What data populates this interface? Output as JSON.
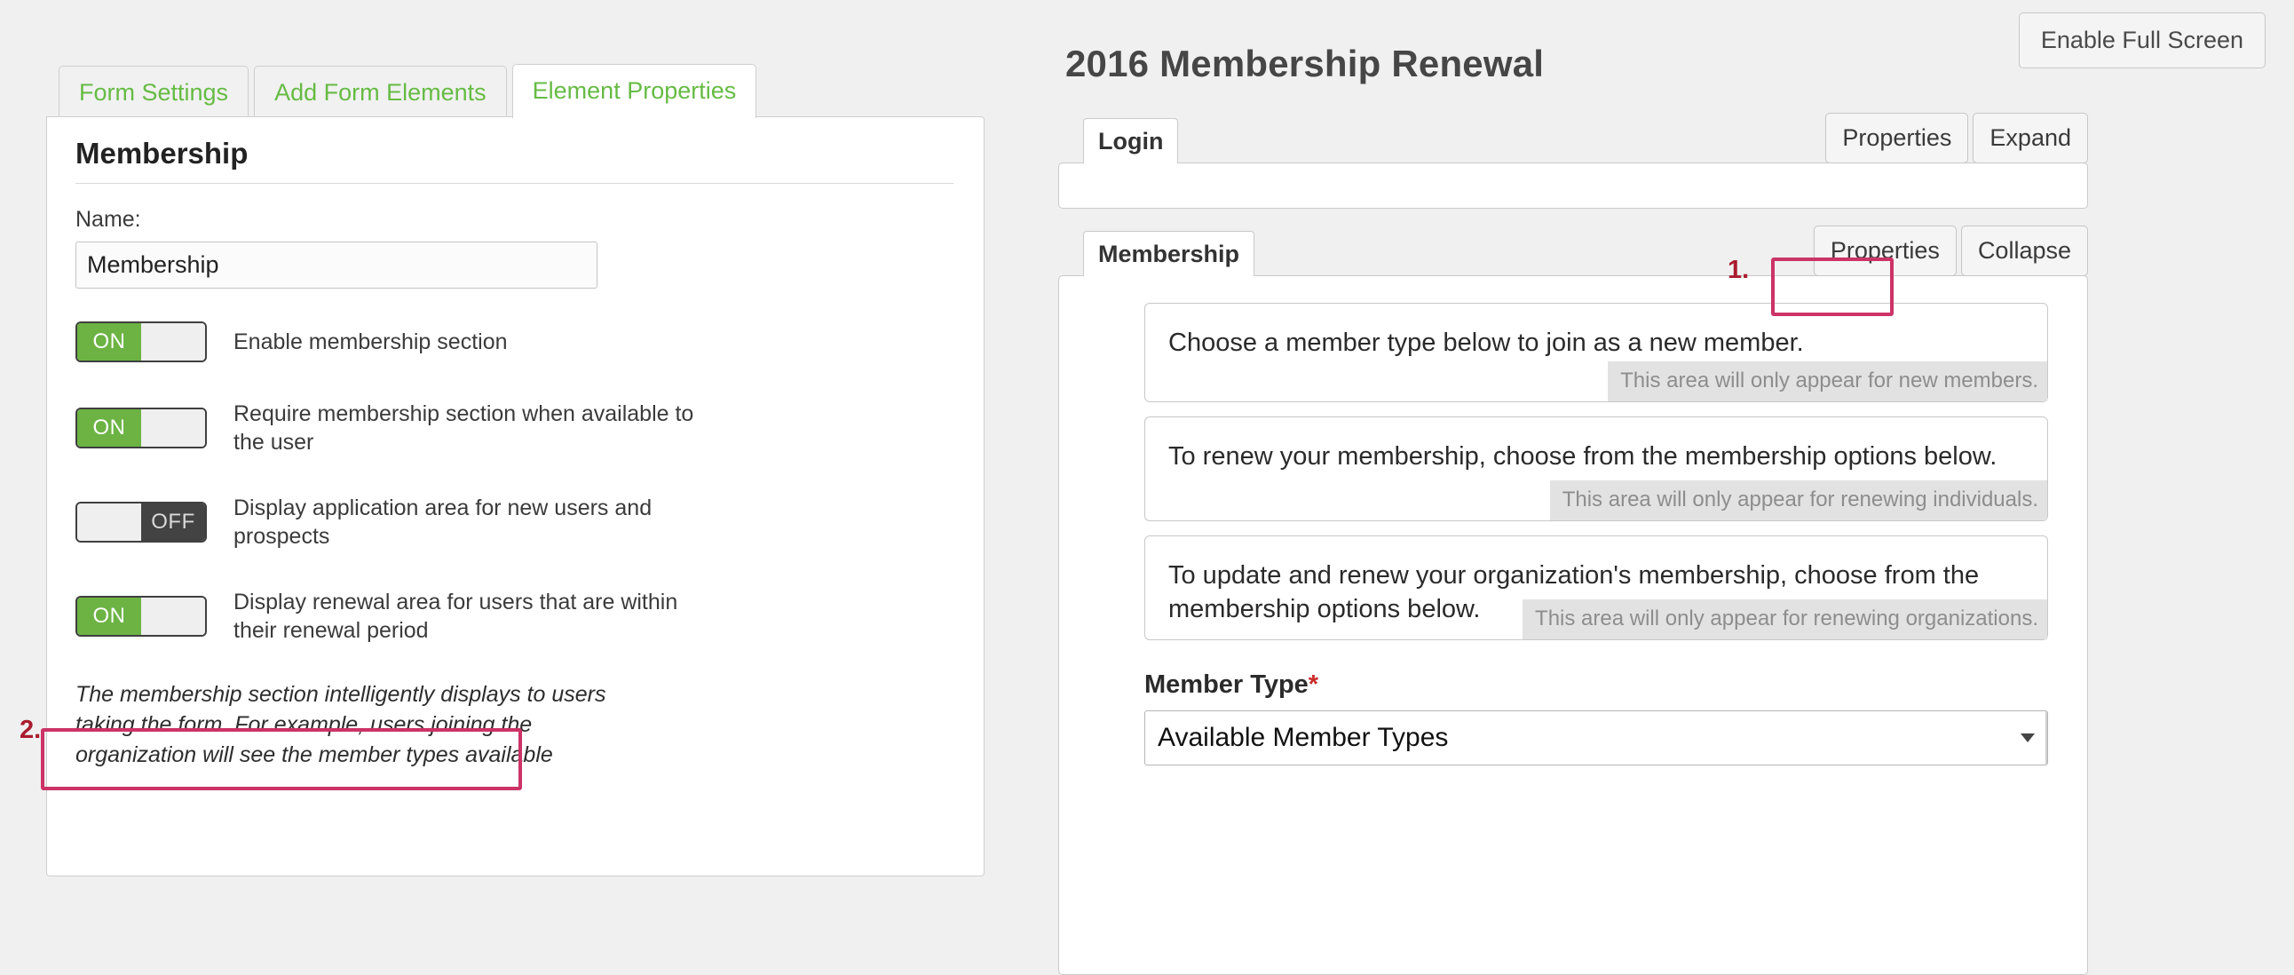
{
  "top": {
    "fullscreen_button": "Enable Full Screen"
  },
  "left_panel": {
    "tabs": [
      {
        "label": "Form Settings",
        "active": false
      },
      {
        "label": "Add Form Elements",
        "active": false
      },
      {
        "label": "Element Properties",
        "active": true
      }
    ],
    "heading": "Membership",
    "name_field": {
      "label": "Name:",
      "value": "Membership",
      "placeholder": "Name"
    },
    "toggles": [
      {
        "state": "ON",
        "on_label": "ON",
        "off_label": "OFF",
        "description": "Enable membership section"
      },
      {
        "state": "ON",
        "on_label": "ON",
        "off_label": "OFF",
        "description": "Require membership section when available to the user"
      },
      {
        "state": "OFF",
        "on_label": "ON",
        "off_label": "OFF",
        "description": "Display application area for new users and prospects"
      },
      {
        "state": "ON",
        "on_label": "ON",
        "off_label": "OFF",
        "description": "Display renewal area for users that are within their renewal period"
      }
    ],
    "helper_note": "The membership section intelligently displays to users taking the form. For example, users joining the organization will see the member types available"
  },
  "right_panel": {
    "form_title": "2016 Membership Renewal",
    "login_section": {
      "tab_label": "Login",
      "properties_button": "Properties",
      "expand_button": "Expand"
    },
    "membership_section": {
      "tab_label": "Membership",
      "properties_button": "Properties",
      "collapse_button": "Collapse",
      "messages": [
        {
          "text": "Choose a member type below to join as a new member.",
          "hint": "This area will only appear for new members."
        },
        {
          "text": "To renew your membership, choose from the membership options below.",
          "hint": "This area will only appear for renewing individuals."
        },
        {
          "text": "To update and renew your organization's membership, choose from the membership options below.",
          "hint": "This area will only appear for renewing organizations."
        }
      ],
      "member_type_field": {
        "label": "Member Type",
        "required_marker": "*",
        "selected_value": "Available Member Types"
      }
    }
  },
  "annotations": [
    {
      "id": "1",
      "label": "1.",
      "target": "membership-properties-button"
    },
    {
      "id": "2",
      "label": "2.",
      "target": "renewal-area-toggle-row"
    }
  ],
  "colors": {
    "accent_green": "#6cb344",
    "tab_green": "#66bb44",
    "highlight_pink": "#cc3366",
    "annotation_red": "#a81c2e",
    "required_red": "#cc2a2a",
    "toggle_off_dark": "#434343",
    "page_background": "#f0f0f0"
  }
}
